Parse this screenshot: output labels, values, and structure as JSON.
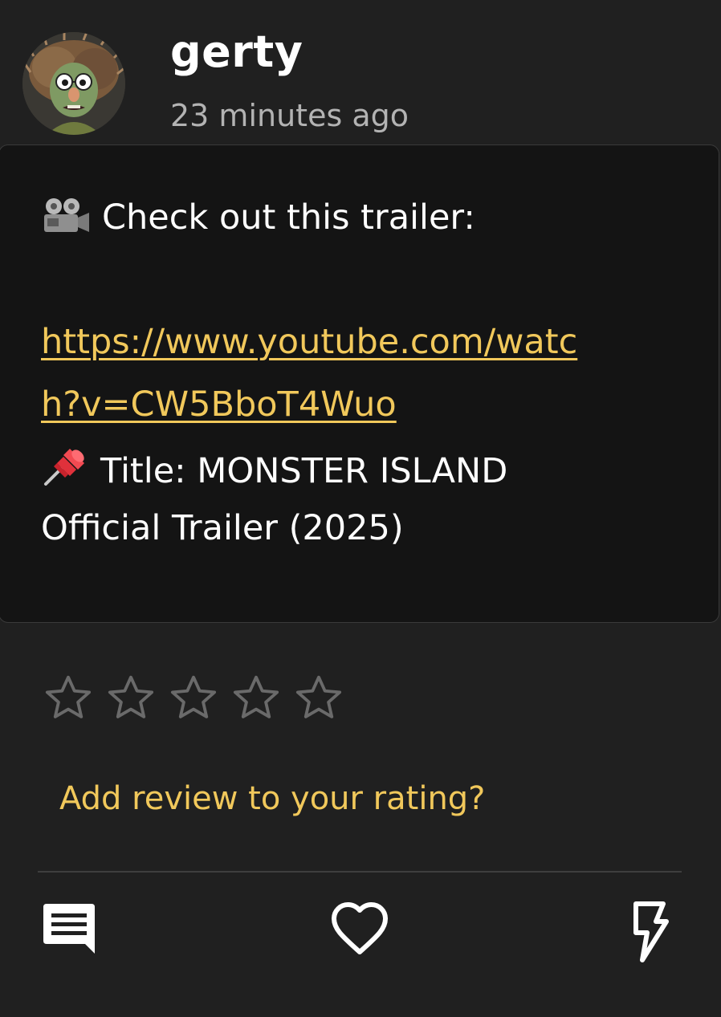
{
  "post": {
    "username": "gerty",
    "timestamp": "23 minutes ago",
    "intro_emoji_icon": "movie-camera-icon",
    "intro_text": "Check out this trailer:",
    "link_line1": "https://www.youtube.com/watc",
    "link_line2": "h?v=CW5BboT4Wuo",
    "title_emoji_icon": "pushpin-icon",
    "title_line1": "Title: MONSTER ISLAND",
    "title_line2": "Official Trailer (2025)"
  },
  "rating": {
    "stars_filled": 0,
    "stars_total": 5,
    "review_prompt": "Add review to your rating?"
  },
  "actions": {
    "comment_icon": "comment-icon",
    "like_icon": "heart-icon",
    "boost_icon": "lightning-bolt-icon"
  },
  "colors": {
    "background": "#202020",
    "card": "#141414",
    "accent": "#f1c85b",
    "star_outline": "#6a6a6a",
    "muted_text": "#b3b3b3"
  }
}
